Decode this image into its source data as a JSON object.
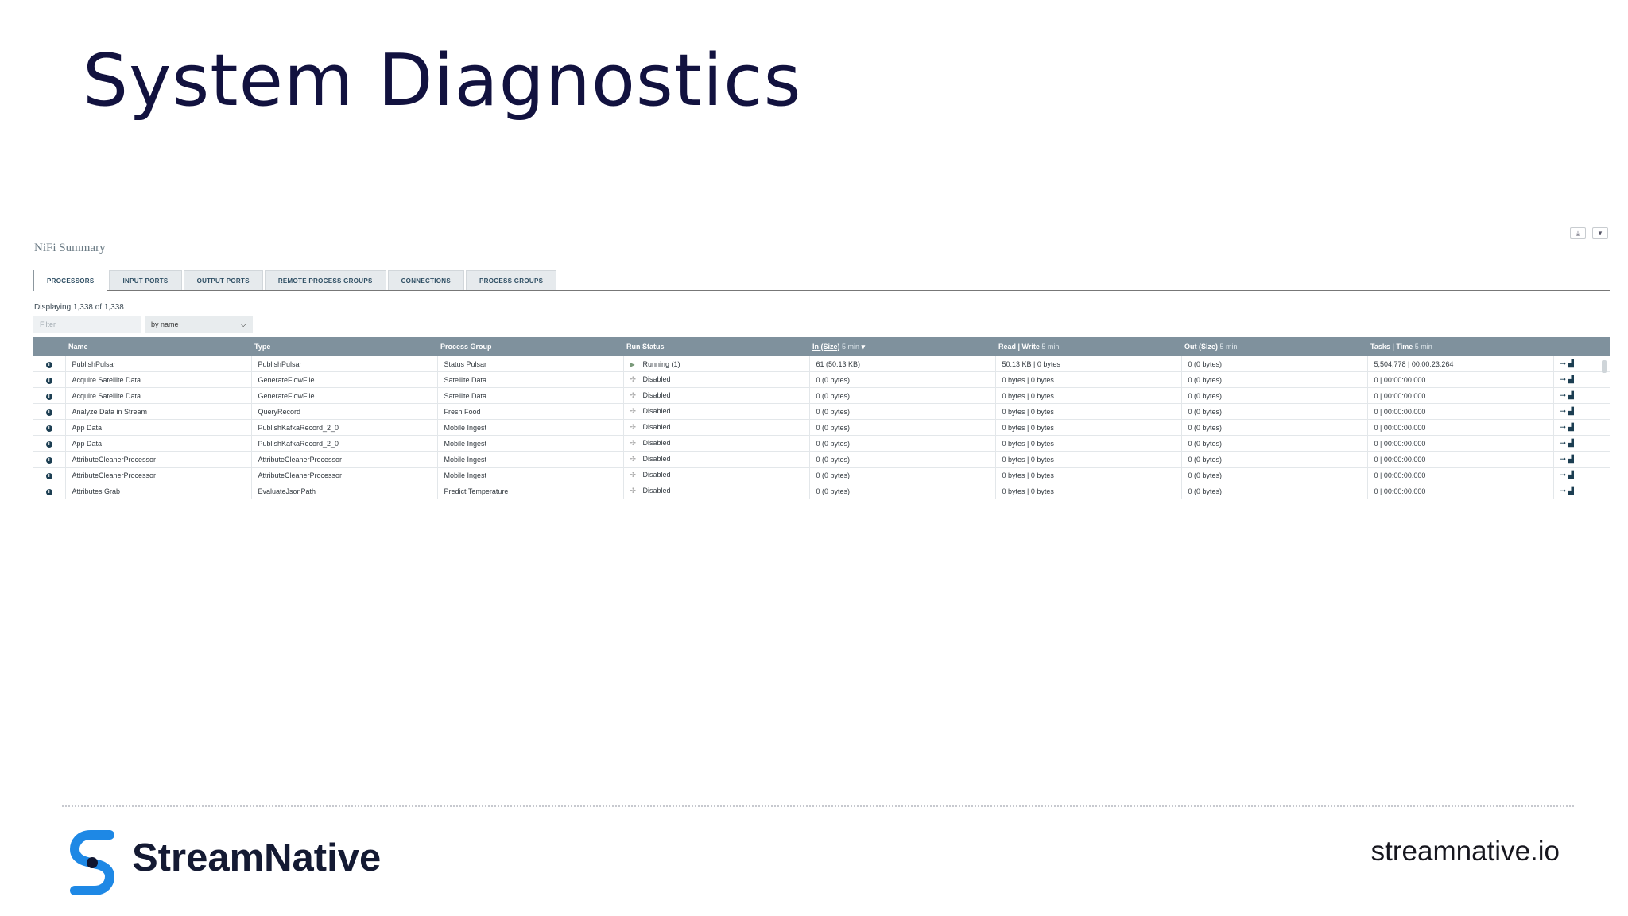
{
  "slide": {
    "title": "System Diagnostics"
  },
  "summary": {
    "title": "NiFi Summary",
    "tabs": [
      {
        "label": "PROCESSORS",
        "active": true
      },
      {
        "label": "INPUT PORTS",
        "active": false
      },
      {
        "label": "OUTPUT PORTS",
        "active": false
      },
      {
        "label": "REMOTE PROCESS GROUPS",
        "active": false
      },
      {
        "label": "CONNECTIONS",
        "active": false
      },
      {
        "label": "PROCESS GROUPS",
        "active": false
      }
    ],
    "displaying": "Displaying 1,338 of 1,338",
    "filter_placeholder": "Filter",
    "filter_by": "by name",
    "columns": {
      "name": "Name",
      "type": "Type",
      "group": "Process Group",
      "status": "Run Status",
      "in": "In (Size)",
      "in_window": "5 min",
      "read": "Read",
      "write": "Write",
      "rw_window": "5 min",
      "out": "Out (Size)",
      "out_window": "5 min",
      "tasks": "Tasks",
      "time": "Time",
      "tasks_window": "5 min"
    },
    "rows": [
      {
        "name": "PublishPulsar",
        "type": "PublishPulsar",
        "group": "Status Pulsar",
        "status": "Running (1)",
        "running": true,
        "in": "61 (50.13 KB)",
        "rw": "50.13 KB | 0 bytes",
        "out": "0 (0 bytes)",
        "tasks": "5,504,778 | 00:00:23.264"
      },
      {
        "name": "Acquire Satellite Data",
        "type": "GenerateFlowFile",
        "group": "Satellite Data",
        "status": "Disabled",
        "running": false,
        "in": "0 (0 bytes)",
        "rw": "0 bytes | 0 bytes",
        "out": "0 (0 bytes)",
        "tasks": "0 | 00:00:00.000"
      },
      {
        "name": "Acquire Satellite Data",
        "type": "GenerateFlowFile",
        "group": "Satellite Data",
        "status": "Disabled",
        "running": false,
        "in": "0 (0 bytes)",
        "rw": "0 bytes | 0 bytes",
        "out": "0 (0 bytes)",
        "tasks": "0 | 00:00:00.000"
      },
      {
        "name": "Analyze Data in Stream",
        "type": "QueryRecord",
        "group": "Fresh Food",
        "status": "Disabled",
        "running": false,
        "in": "0 (0 bytes)",
        "rw": "0 bytes | 0 bytes",
        "out": "0 (0 bytes)",
        "tasks": "0 | 00:00:00.000"
      },
      {
        "name": "App Data",
        "type": "PublishKafkaRecord_2_0",
        "group": "Mobile Ingest",
        "status": "Disabled",
        "running": false,
        "in": "0 (0 bytes)",
        "rw": "0 bytes | 0 bytes",
        "out": "0 (0 bytes)",
        "tasks": "0 | 00:00:00.000"
      },
      {
        "name": "App Data",
        "type": "PublishKafkaRecord_2_0",
        "group": "Mobile Ingest",
        "status": "Disabled",
        "running": false,
        "in": "0 (0 bytes)",
        "rw": "0 bytes | 0 bytes",
        "out": "0 (0 bytes)",
        "tasks": "0 | 00:00:00.000"
      },
      {
        "name": "AttributeCleanerProcessor",
        "type": "AttributeCleanerProcessor",
        "group": "Mobile Ingest",
        "status": "Disabled",
        "running": false,
        "in": "0 (0 bytes)",
        "rw": "0 bytes | 0 bytes",
        "out": "0 (0 bytes)",
        "tasks": "0 | 00:00:00.000"
      },
      {
        "name": "AttributeCleanerProcessor",
        "type": "AttributeCleanerProcessor",
        "group": "Mobile Ingest",
        "status": "Disabled",
        "running": false,
        "in": "0 (0 bytes)",
        "rw": "0 bytes | 0 bytes",
        "out": "0 (0 bytes)",
        "tasks": "0 | 00:00:00.000"
      },
      {
        "name": "Attributes Grab",
        "type": "EvaluateJsonPath",
        "group": "Predict Temperature",
        "status": "Disabled",
        "running": false,
        "in": "0 (0 bytes)",
        "rw": "0 bytes | 0 bytes",
        "out": "0 (0 bytes)",
        "tasks": "0 | 00:00:00.000"
      }
    ]
  },
  "footer": {
    "brand": "StreamNative",
    "site": "streamnative.io"
  },
  "colors": {
    "title": "#12123f",
    "header": "#7f919d",
    "logo": "#1e88e5"
  },
  "icons": {
    "info": "info-circle-icon",
    "running": "play-icon",
    "disabled": "disabled-icon",
    "goto": "arrow-right-icon",
    "chart": "bar-chart-icon"
  }
}
